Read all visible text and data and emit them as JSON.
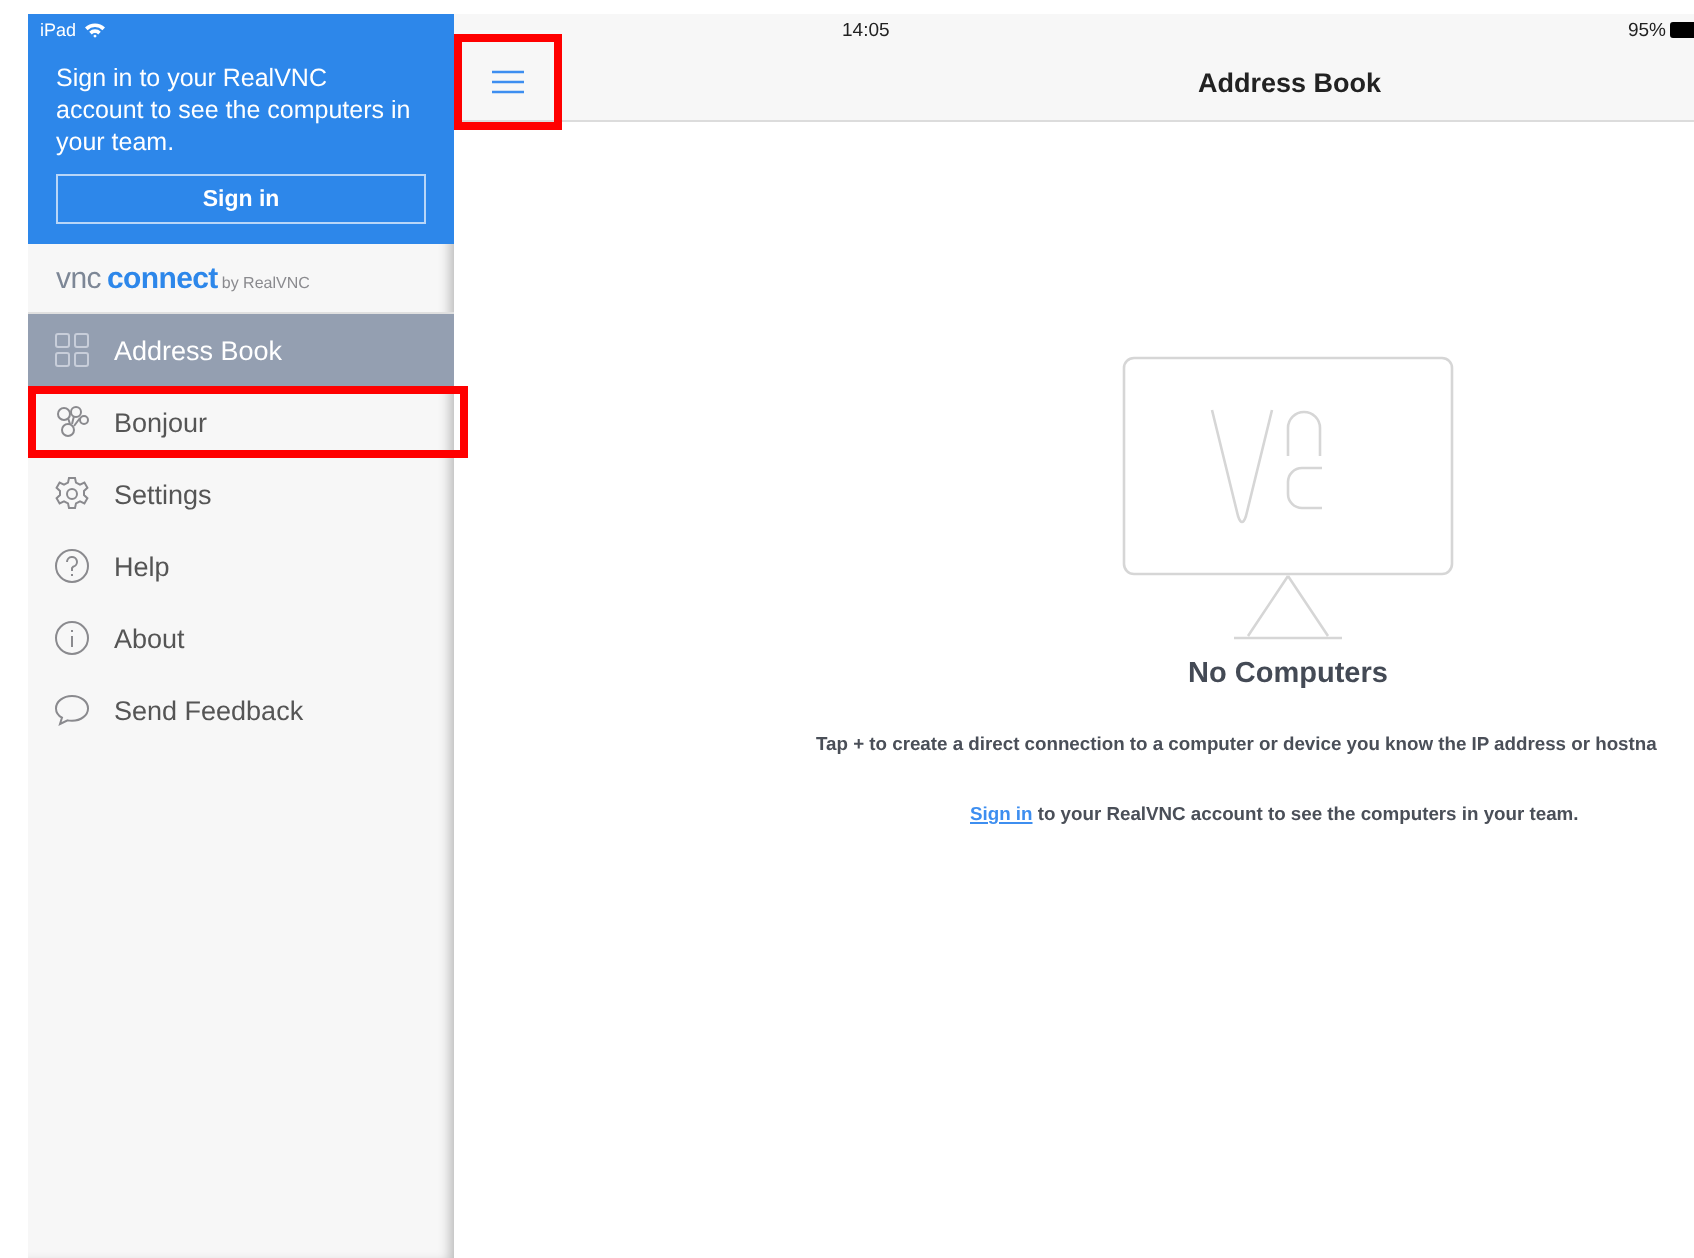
{
  "status_bar": {
    "device": "iPad",
    "time": "14:05",
    "battery": "95%"
  },
  "sidebar": {
    "prompt": "Sign in to your RealVNC account to see the computers in your team.",
    "sign_in_button": "Sign in",
    "logo": {
      "part_1": "vnc",
      "part_2": "connect",
      "part_3": "by RealVNC"
    },
    "items": [
      {
        "label": "Address Book",
        "kind": "grid",
        "selected": true,
        "annotated": false
      },
      {
        "label": "Bonjour",
        "kind": "bonjour",
        "selected": false,
        "annotated": true
      },
      {
        "label": "Settings",
        "kind": "gear",
        "selected": false,
        "annotated": false
      },
      {
        "label": "Help",
        "kind": "help",
        "selected": false,
        "annotated": false
      },
      {
        "label": "About",
        "kind": "info",
        "selected": false,
        "annotated": false
      },
      {
        "label": "Send Feedback",
        "kind": "chat",
        "selected": false,
        "annotated": false
      }
    ]
  },
  "nav_bar": {
    "title": "Address Book",
    "menu_annotated": true
  },
  "empty_state": {
    "heading": "No Computers",
    "hint": "Tap + to create a direct connection to a computer or device you know the IP address or hostna",
    "note_link": "Sign in",
    "note_text": " to your RealVNC account to see the computers in your team."
  }
}
